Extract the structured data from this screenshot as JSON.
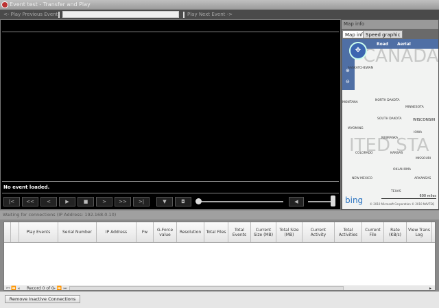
{
  "window": {
    "title": "Event test - Transfer and Play"
  },
  "toolbar": {
    "prev_label": "<- Play Previous Event",
    "event_value": "",
    "next_label": "Play Next Event ->"
  },
  "player": {
    "status": "No event loaded.",
    "buttons": [
      "|<",
      "<<",
      "<",
      "▶",
      "■",
      ">",
      ">>",
      ">|"
    ],
    "marker_icon": "marker-icon",
    "snapshot_icon": "camera-icon",
    "volume_icon": "speaker-icon",
    "seek_position": 0,
    "volume_level": 1.0
  },
  "map": {
    "header": "Map info",
    "tabs": [
      "Map info",
      "Speed graphic"
    ],
    "active_tab": 0,
    "modes": [
      "Road",
      "Aerial"
    ],
    "labels": [
      "Saskatchewan",
      "Montana",
      "North Dakota",
      "Minnesota",
      "Wisconsin",
      "South Dakota",
      "Wyoming",
      "Iowa",
      "Nebraska",
      "Colorado",
      "Kansas",
      "Missouri",
      "Oklahoma",
      "New Mexico",
      "Arkansas",
      "Texas"
    ],
    "watermarks": [
      "CANADA",
      "ITED STA"
    ],
    "brand": "bing",
    "scale": "600 miles",
    "copyright": "© 2010 Microsoft Corporation  © 2010 NAVTEQ"
  },
  "status": "Waiting for connections (IP Address: 192.168.0.10)",
  "grid": {
    "columns": [
      "",
      "",
      "Play Events",
      "Serial Number",
      "IP Address",
      "Fw",
      "G-Force value",
      "Resolution",
      "Total Files",
      "Total Events",
      "Current Size (MB)",
      "Total Size (MB)",
      "Current Activity",
      "Total Activities",
      "Current File",
      "Rate (KB/s)",
      "View Trans Log"
    ],
    "rows": [],
    "record_label": "Record 0 of 0"
  },
  "actions": {
    "remove_label": "Remove Inactive Connections"
  },
  "colors": {
    "map_accent": "#4f6fa5",
    "video_bg": "#000000"
  }
}
